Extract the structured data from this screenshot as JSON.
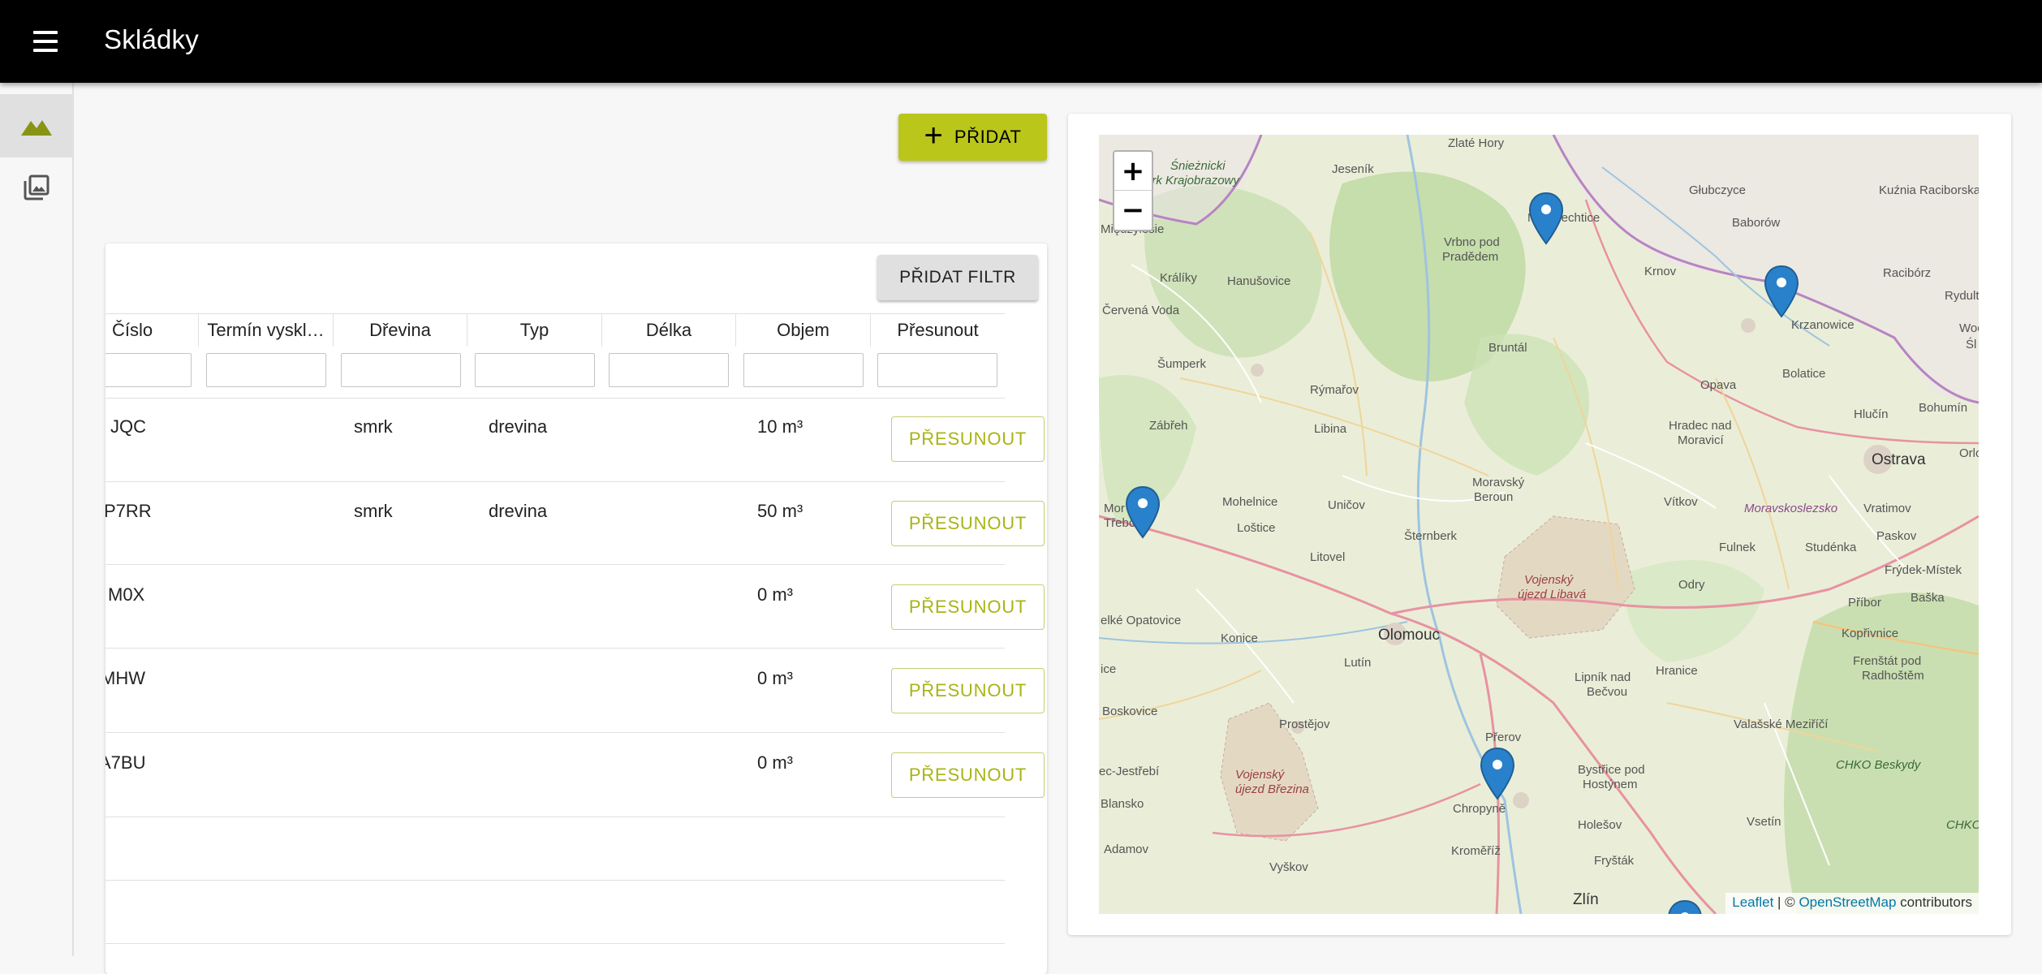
{
  "app": {
    "title": "Skládky"
  },
  "nav": {
    "items": [
      {
        "name": "landscape-icon",
        "active": true
      },
      {
        "name": "photo-library-icon",
        "active": false
      }
    ]
  },
  "toolbar": {
    "add_label": "PŘIDAT"
  },
  "table": {
    "filter_button": "PŘIDAT FILTR",
    "columns": [
      "Číslo",
      "Termín vyskl…",
      "Dřevina",
      "Typ",
      "Délka",
      "Objem",
      "Přesunout"
    ],
    "rows": [
      {
        "cislo": "JQC",
        "termin": "",
        "drevina": "smrk",
        "typ": "drevina",
        "delka": "",
        "objem": "10 m³",
        "action": "PŘESUNOUT"
      },
      {
        "cislo": "P7RR",
        "termin": "",
        "drevina": "smrk",
        "typ": "drevina",
        "delka": "",
        "objem": "50 m³",
        "action": "PŘESUNOUT"
      },
      {
        "cislo": "M0X",
        "termin": "",
        "drevina": "",
        "typ": "",
        "delka": "",
        "objem": "0 m³",
        "action": "PŘESUNOUT"
      },
      {
        "cislo": "MHW",
        "termin": "",
        "drevina": "",
        "typ": "",
        "delka": "",
        "objem": "0 m³",
        "action": "PŘESUNOUT"
      },
      {
        "cislo": "A7BU",
        "termin": "",
        "drevina": "",
        "typ": "",
        "delka": "",
        "objem": "0 m³",
        "action": "PŘESUNOUT"
      }
    ]
  },
  "map": {
    "zoom_in": "+",
    "zoom_out": "−",
    "attribution": {
      "leaflet": "Leaflet",
      "sep": " | © ",
      "osm": "OpenStreetMap",
      "suffix": " contributors"
    },
    "places": {
      "zlate_hory": "Zlaté Hory",
      "jesenik": "Jeseník",
      "snieznicki": "Śnieżnicki",
      "park_krajobrazowy": "ark Krajobrazowy",
      "glubczyce": "Głubczyce",
      "kuznia": "Kuźnia Raciborska",
      "miedzylesie": "Międzylesie",
      "mesto_albrechtice": "Mě  lbrechtice",
      "vrbno": "Vrbno pod",
      "pradedem": "Pradědem",
      "baborow": "Baborów",
      "kraliky": "Králíky",
      "hanusovice": "Hanušovice",
      "krnov": "Krnov",
      "racibor": "Racibórz",
      "rydultowy": "Rydultow",
      "cervena_voda": "Červená Voda",
      "bruntal": "Bruntál",
      "krzanowice": "Krzanowice",
      "sumperk": "Šumperk",
      "rymarov": "Rýmařov",
      "opava": "Opava",
      "bolatice": "Bolatice",
      "bohumin": "Bohumín",
      "zabreh": "Zábřeh",
      "libina": "Libina",
      "hradec": "Hradec nad",
      "moravici": "Moravicí",
      "hlucin": "Hlučín",
      "ostrava": "Ostrava",
      "moravsky": "Moravský",
      "beroun": "Beroun",
      "mohelnice": "Mohelnice",
      "unicov": "Uničov",
      "vitkov": "Vítkov",
      "moravskoslezsko": "Moravskoslezsko",
      "vratimov": "Vratimov",
      "morav": "Mor",
      "trebova": "Třebová",
      "lostice": "Loštice",
      "sternberk": "Šternberk",
      "fulnek": "Fulnek",
      "studenka": "Studénka",
      "paskov": "Paskov",
      "litovel": "Litovel",
      "vojensky": "Vojenský",
      "ujezd_libava": "újezd Libavá",
      "odry": "Odry",
      "frydek": "Frýdek-Místek",
      "velke_opatovice": "elké Opatovice",
      "olomouc": "Olomouc",
      "pribor": "Příbor",
      "baska": "Baška",
      "konice": "Konice",
      "kuce": "ice",
      "lutin": "Lutín",
      "hranice": "Hranice",
      "koprivnice": "Kopřivnice",
      "boskovice": "Boskovice",
      "lipnik": "Lipník nad",
      "becvou": "Bečvou",
      "frenstat": "Frenštát pod",
      "radhostem": "Radhoštěm",
      "prostejov": "Prostějov",
      "valasske": "Valašské Meziříčí",
      "prerov": "Přerov",
      "vojensky2": "Vojenský",
      "ujezd_brezina": "újezd Březina",
      "jevicko": "ec-Jestřebí",
      "bystrice": "Bystřice pod",
      "hostynem": "Hostýnem",
      "chko": "CHKO Beskydy",
      "blansko": "Blansko",
      "chropyne": "Chropyně",
      "holesov": "Holešov",
      "vsetin": "Vsetín",
      "chko2": "CHKO",
      "adamov": "Adamov",
      "kromeriz": "Kroměříž",
      "frystak": "Fryšták",
      "vyskov": "Vyškov",
      "zlin": "Zlín",
      "wod": "Wod",
      "sla": "Śl",
      "orlo": "Orlo"
    }
  },
  "colors": {
    "accent": "#bac61a",
    "appbar": "#000000",
    "marker": "#2a81cb"
  }
}
